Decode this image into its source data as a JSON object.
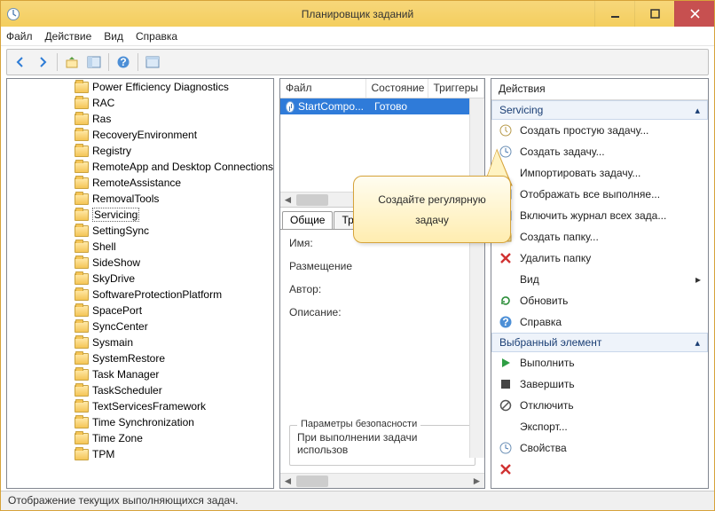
{
  "window": {
    "title": "Планировщик заданий"
  },
  "menu": {
    "file": "Файл",
    "action": "Действие",
    "view": "Вид",
    "help": "Справка"
  },
  "tree": {
    "items": [
      "Power Efficiency Diagnostics",
      "RAC",
      "Ras",
      "RecoveryEnvironment",
      "Registry",
      "RemoteApp and Desktop Connections",
      "RemoteAssistance",
      "RemovalTools",
      "Servicing",
      "SettingSync",
      "Shell",
      "SideShow",
      "SkyDrive",
      "SoftwareProtectionPlatform",
      "SpacePort",
      "SyncCenter",
      "Sysmain",
      "SystemRestore",
      "Task Manager",
      "TaskScheduler",
      "TextServicesFramework",
      "Time Synchronization",
      "Time Zone",
      "TPM"
    ],
    "selected_index": 8
  },
  "grid": {
    "columns": {
      "file": "Файл",
      "state": "Состояние",
      "triggers": "Триггеры"
    },
    "rows": [
      {
        "file": "StartCompo...",
        "state": "Готово"
      }
    ]
  },
  "tabs": {
    "general": "Общие",
    "triggers_short": "Тр"
  },
  "details": {
    "name_label": "Имя:",
    "location_label": "Размещение",
    "author_label": "Автор:",
    "description_label": "Описание:",
    "security_group_title": "Параметры безопасности",
    "security_line": "При выполнении задачи использов"
  },
  "actions_header": "Действия",
  "sections": {
    "servicing": "Servicing",
    "selected": "Выбранный элемент"
  },
  "actions": {
    "create_basic": "Создать простую задачу...",
    "create_task": "Создать задачу...",
    "import_task": "Импортировать задачу...",
    "show_running": "Отображать все выполняе...",
    "enable_history": "Включить журнал всех зада...",
    "new_folder": "Создать папку...",
    "delete_folder": "Удалить папку",
    "view": "Вид",
    "refresh": "Обновить",
    "help": "Справка",
    "run": "Выполнить",
    "end": "Завершить",
    "disable": "Отключить",
    "export": "Экспорт...",
    "properties": "Свойства"
  },
  "callout": {
    "text": "Создайте регулярную задачу"
  },
  "status": {
    "text": "Отображение текущих выполняющихся задач."
  }
}
